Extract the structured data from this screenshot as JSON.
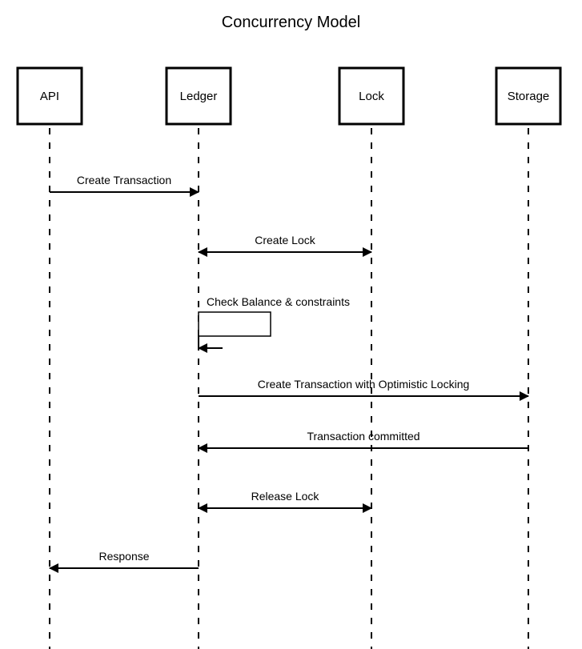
{
  "title": "Concurrency Model",
  "participants": {
    "api": "API",
    "ledger": "Ledger",
    "lock": "Lock",
    "storage": "Storage"
  },
  "messages": {
    "m1": "Create Transaction",
    "m2": "Create Lock",
    "m3": "Check Balance & constraints",
    "m4": "Create Transaction with Optimistic Locking",
    "m5": "Transaction committed",
    "m6": "Release Lock",
    "m7": "Response"
  }
}
